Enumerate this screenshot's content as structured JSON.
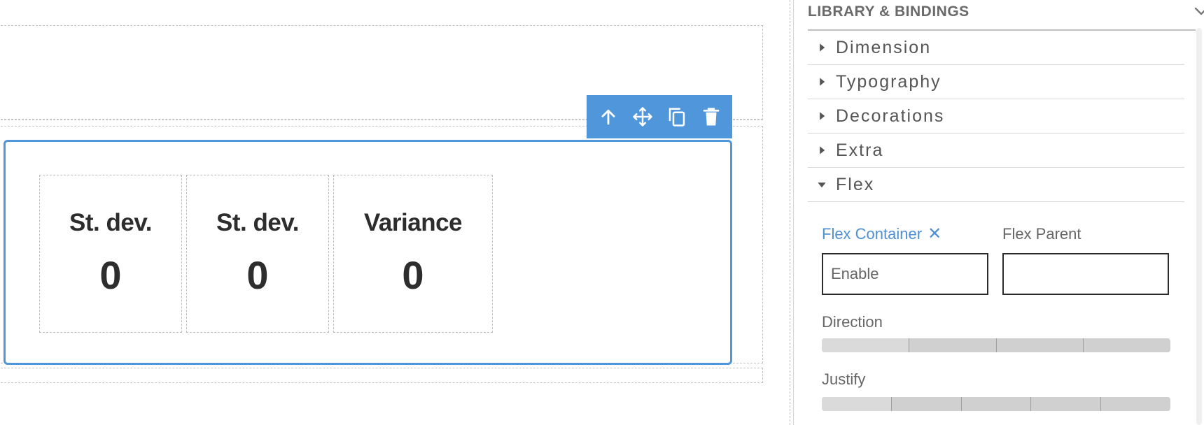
{
  "canvas": {
    "toolbar": {
      "icons": [
        "arrow-up-icon",
        "move-icon",
        "copy-icon",
        "trash-icon"
      ]
    },
    "cells": [
      {
        "label": "St. dev.",
        "value": "0"
      },
      {
        "label": "St. dev.",
        "value": "0"
      },
      {
        "label": "Variance",
        "value": "0"
      }
    ]
  },
  "panel": {
    "title": "LIBRARY & BINDINGS",
    "sections": [
      {
        "label": "Dimension",
        "expanded": false
      },
      {
        "label": "Typography",
        "expanded": false
      },
      {
        "label": "Decorations",
        "expanded": false
      },
      {
        "label": "Extra",
        "expanded": false
      },
      {
        "label": "Flex",
        "expanded": true
      }
    ],
    "flex": {
      "container_label": "Flex Container",
      "container_clear": "✕",
      "container_value": "Enable",
      "parent_label": "Flex Parent",
      "parent_value": "",
      "direction_label": "Direction",
      "direction_options": 4,
      "justify_label": "Justify",
      "justify_options": 5
    }
  },
  "colors": {
    "accent": "#4f96db",
    "text_dark": "#2d2d2d",
    "text_muted": "#666666",
    "link_blue": "#4f8fd4",
    "dashed": "#c4c4c4"
  }
}
